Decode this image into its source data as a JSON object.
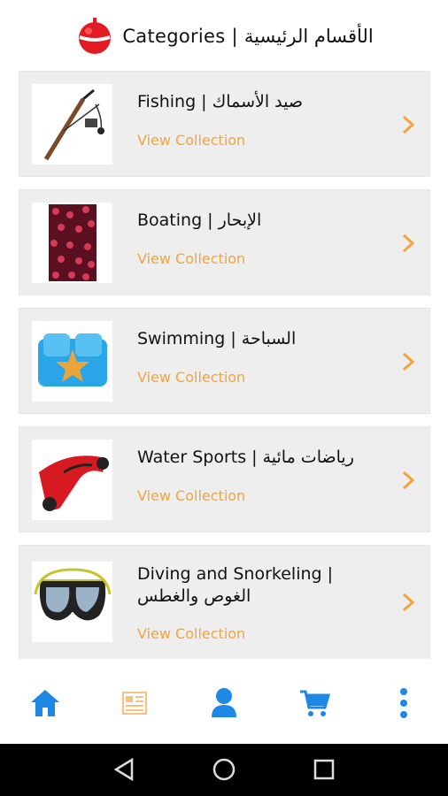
{
  "header": {
    "title": "Categories | الأقسام الرئيسية",
    "logo_icon": "fishing-bobber-icon"
  },
  "categories": [
    {
      "name": "Fishing | صيد الأسماك",
      "link": "View Collection",
      "thumb_icon": "fishing-rod-image"
    },
    {
      "name": "Boating | الإبحار",
      "link": "View Collection",
      "thumb_icon": "rope-net-image"
    },
    {
      "name": "Swimming | السباحة",
      "link": "View Collection",
      "thumb_icon": "swim-float-image"
    },
    {
      "name": "Water Sports | رياضات مائية",
      "link": "View Collection",
      "thumb_icon": "water-scooter-image"
    },
    {
      "name": "Diving and Snorkeling | الغوص والغطس",
      "link": "View Collection",
      "thumb_icon": "diving-mask-image"
    }
  ],
  "nav": {
    "items": [
      "home-icon",
      "catalog-icon",
      "account-icon",
      "cart-icon",
      "more-icon"
    ],
    "colors": {
      "active": "#1e88e5",
      "inactive": "#f6c27d"
    }
  },
  "system": {
    "items": [
      "back-icon",
      "home-circle-icon",
      "recents-icon"
    ]
  },
  "colors": {
    "accent": "#f3a43b",
    "card_bg": "#eeeeee"
  }
}
